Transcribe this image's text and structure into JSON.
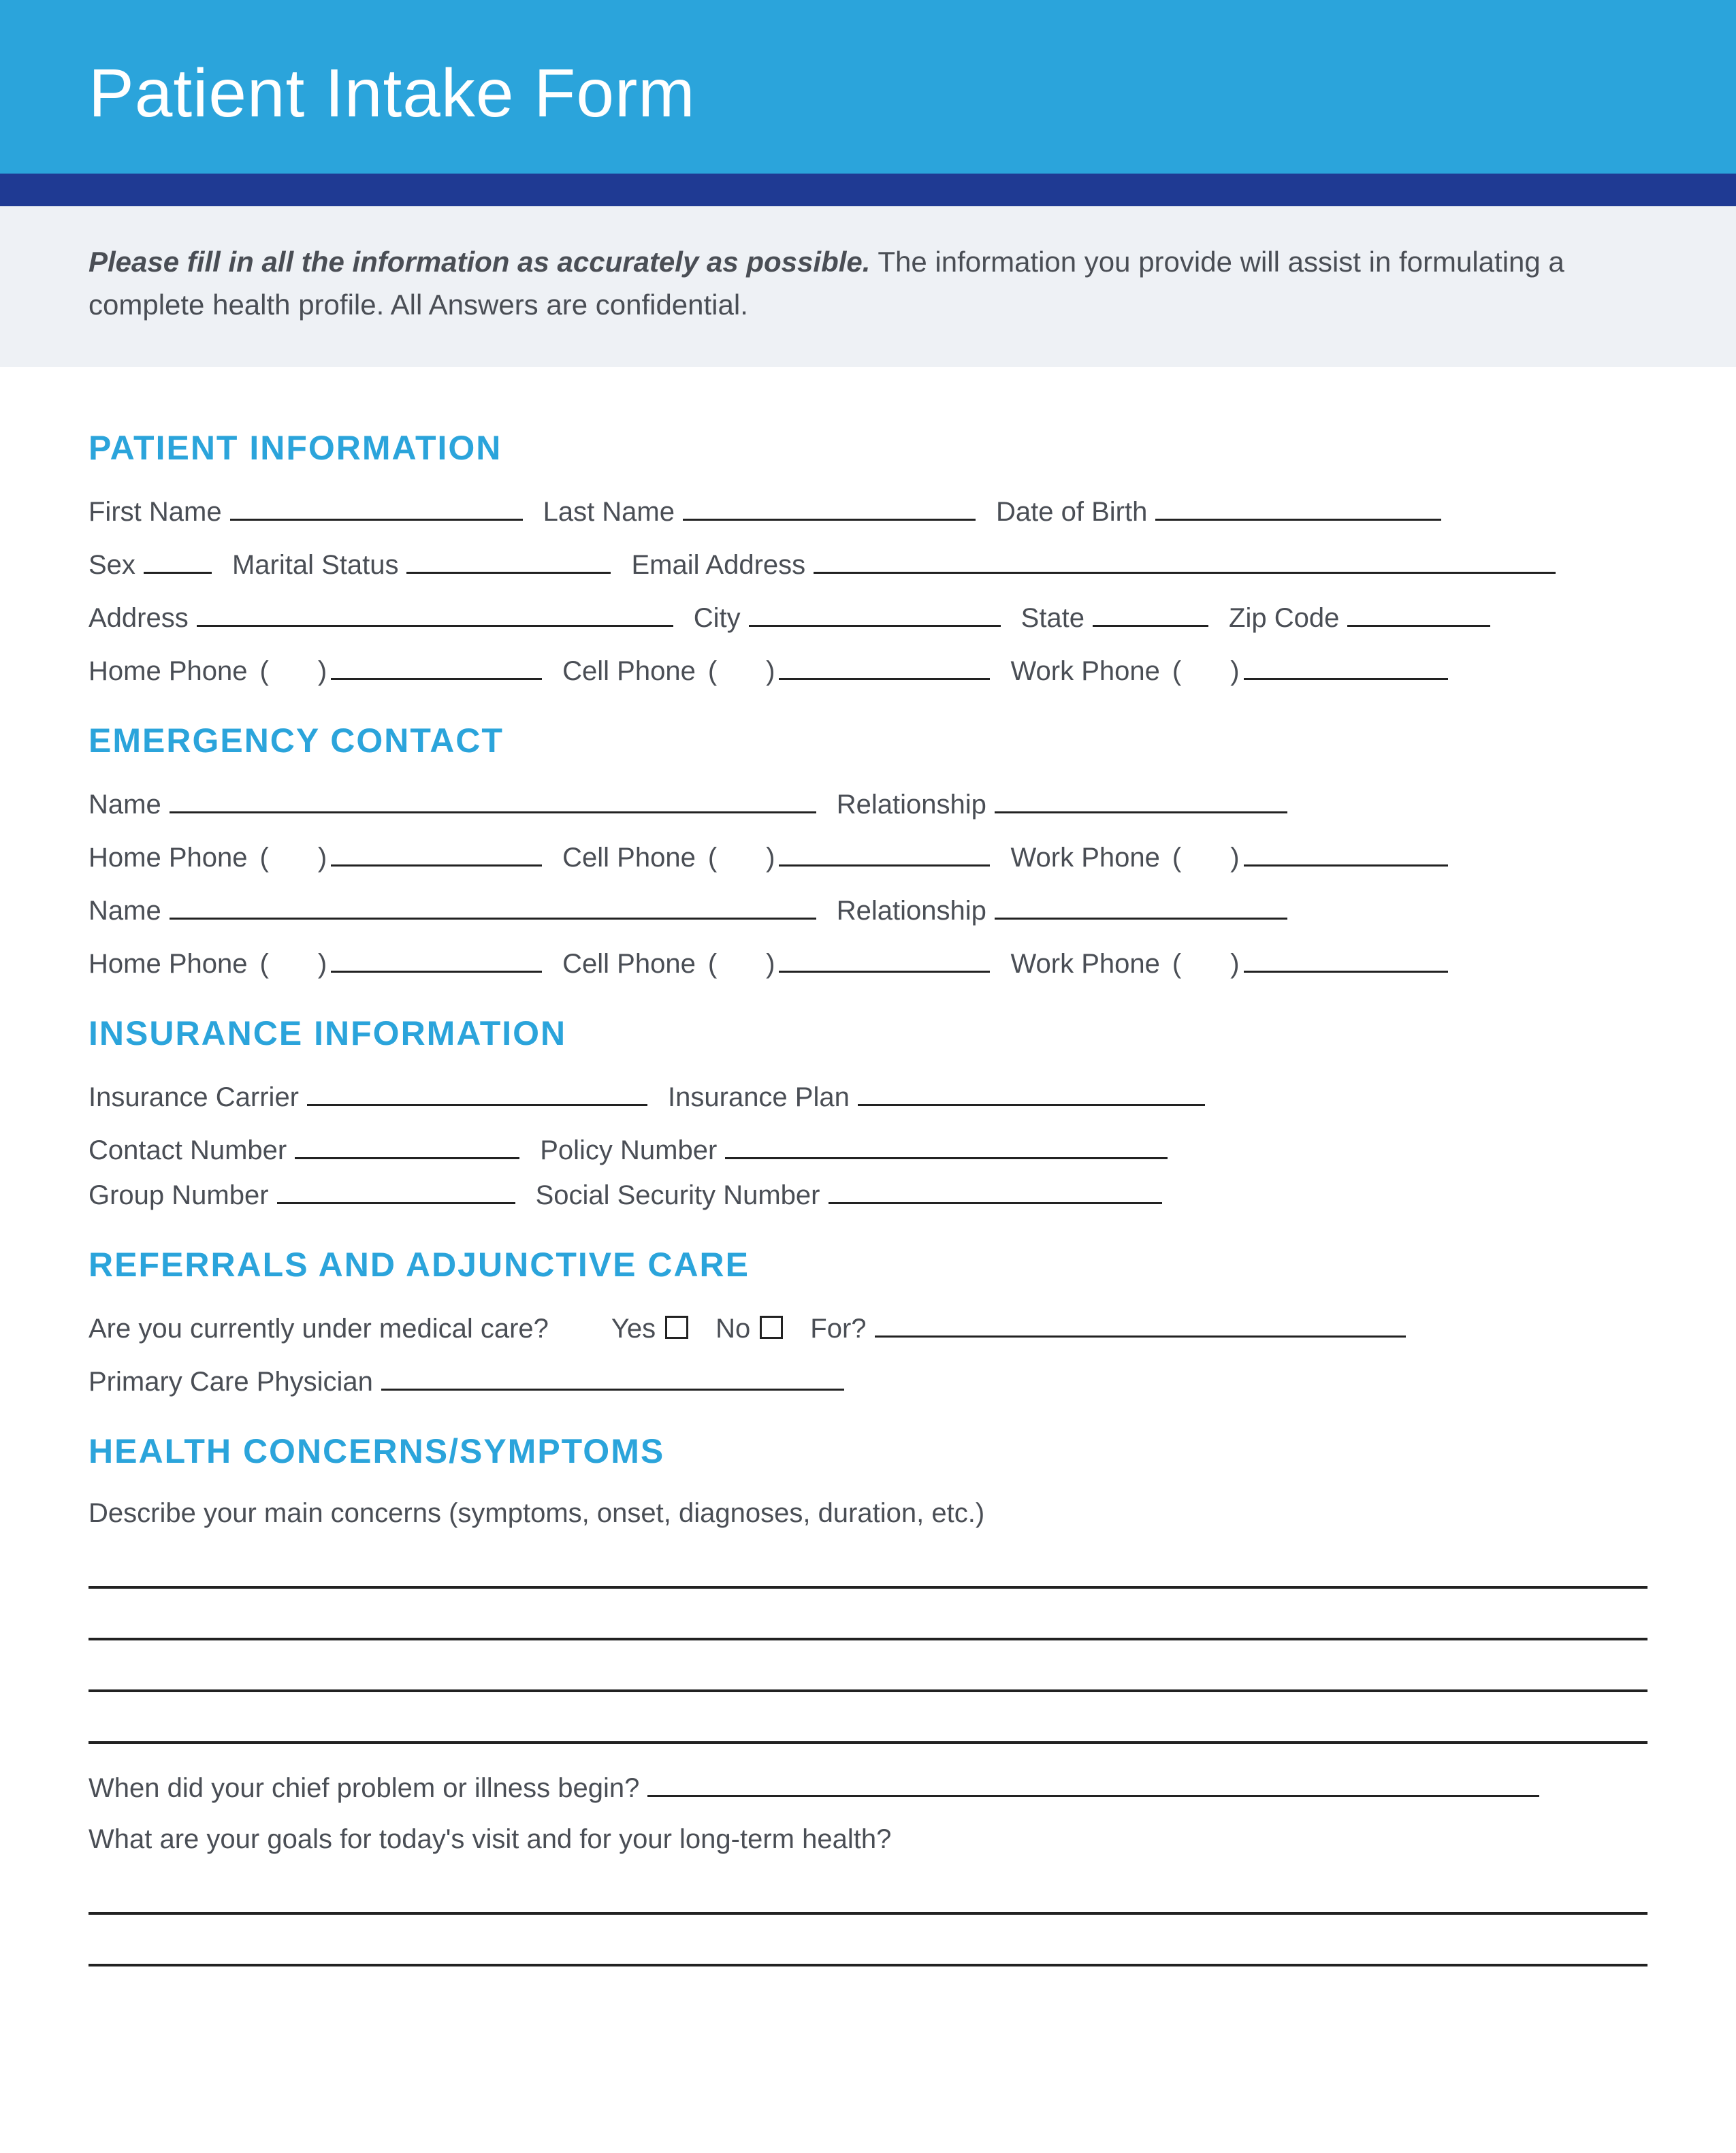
{
  "header": {
    "title": "Patient Intake Form"
  },
  "intro": {
    "bold": "Please fill in all the information as accurately as possible.",
    "rest": " The information you provide will assist in formulating a complete health profile. All Answers are confidential."
  },
  "sections": {
    "patient_info": {
      "title": "PATIENT INFORMATION",
      "first_name": "First Name",
      "last_name": "Last Name",
      "dob": "Date of Birth",
      "sex": "Sex",
      "marital": "Marital Status",
      "email": "Email Address",
      "address": "Address",
      "city": "City",
      "state": "State",
      "zip": "Zip Code",
      "home_phone": "Home Phone",
      "cell_phone": "Cell Phone",
      "work_phone": "Work Phone"
    },
    "emergency": {
      "title": "EMERGENCY CONTACT",
      "name": "Name",
      "relationship": "Relationship",
      "home_phone": "Home Phone",
      "cell_phone": "Cell Phone",
      "work_phone": "Work Phone"
    },
    "insurance": {
      "title": "INSURANCE INFORMATION",
      "carrier": "Insurance Carrier",
      "plan": "Insurance Plan",
      "contact": "Contact Number",
      "policy": "Policy Number",
      "group": "Group Number",
      "ssn": "Social Security Number"
    },
    "referrals": {
      "title": "REFERRALS AND ADJUNCTIVE CARE",
      "under_care": "Are you currently under medical care?",
      "yes": "Yes",
      "no": "No",
      "for": "For?",
      "pcp": "Primary Care Physician"
    },
    "health": {
      "title": "HEALTH CONCERNS/SYMPTOMS",
      "describe": "Describe your main concerns (symptoms, onset, diagnoses, duration, etc.)",
      "when": "When did your chief problem or illness begin?",
      "goals": "What are your goals for today's visit and for your long-term health?"
    }
  },
  "paren_open": "(",
  "paren_close": ")"
}
